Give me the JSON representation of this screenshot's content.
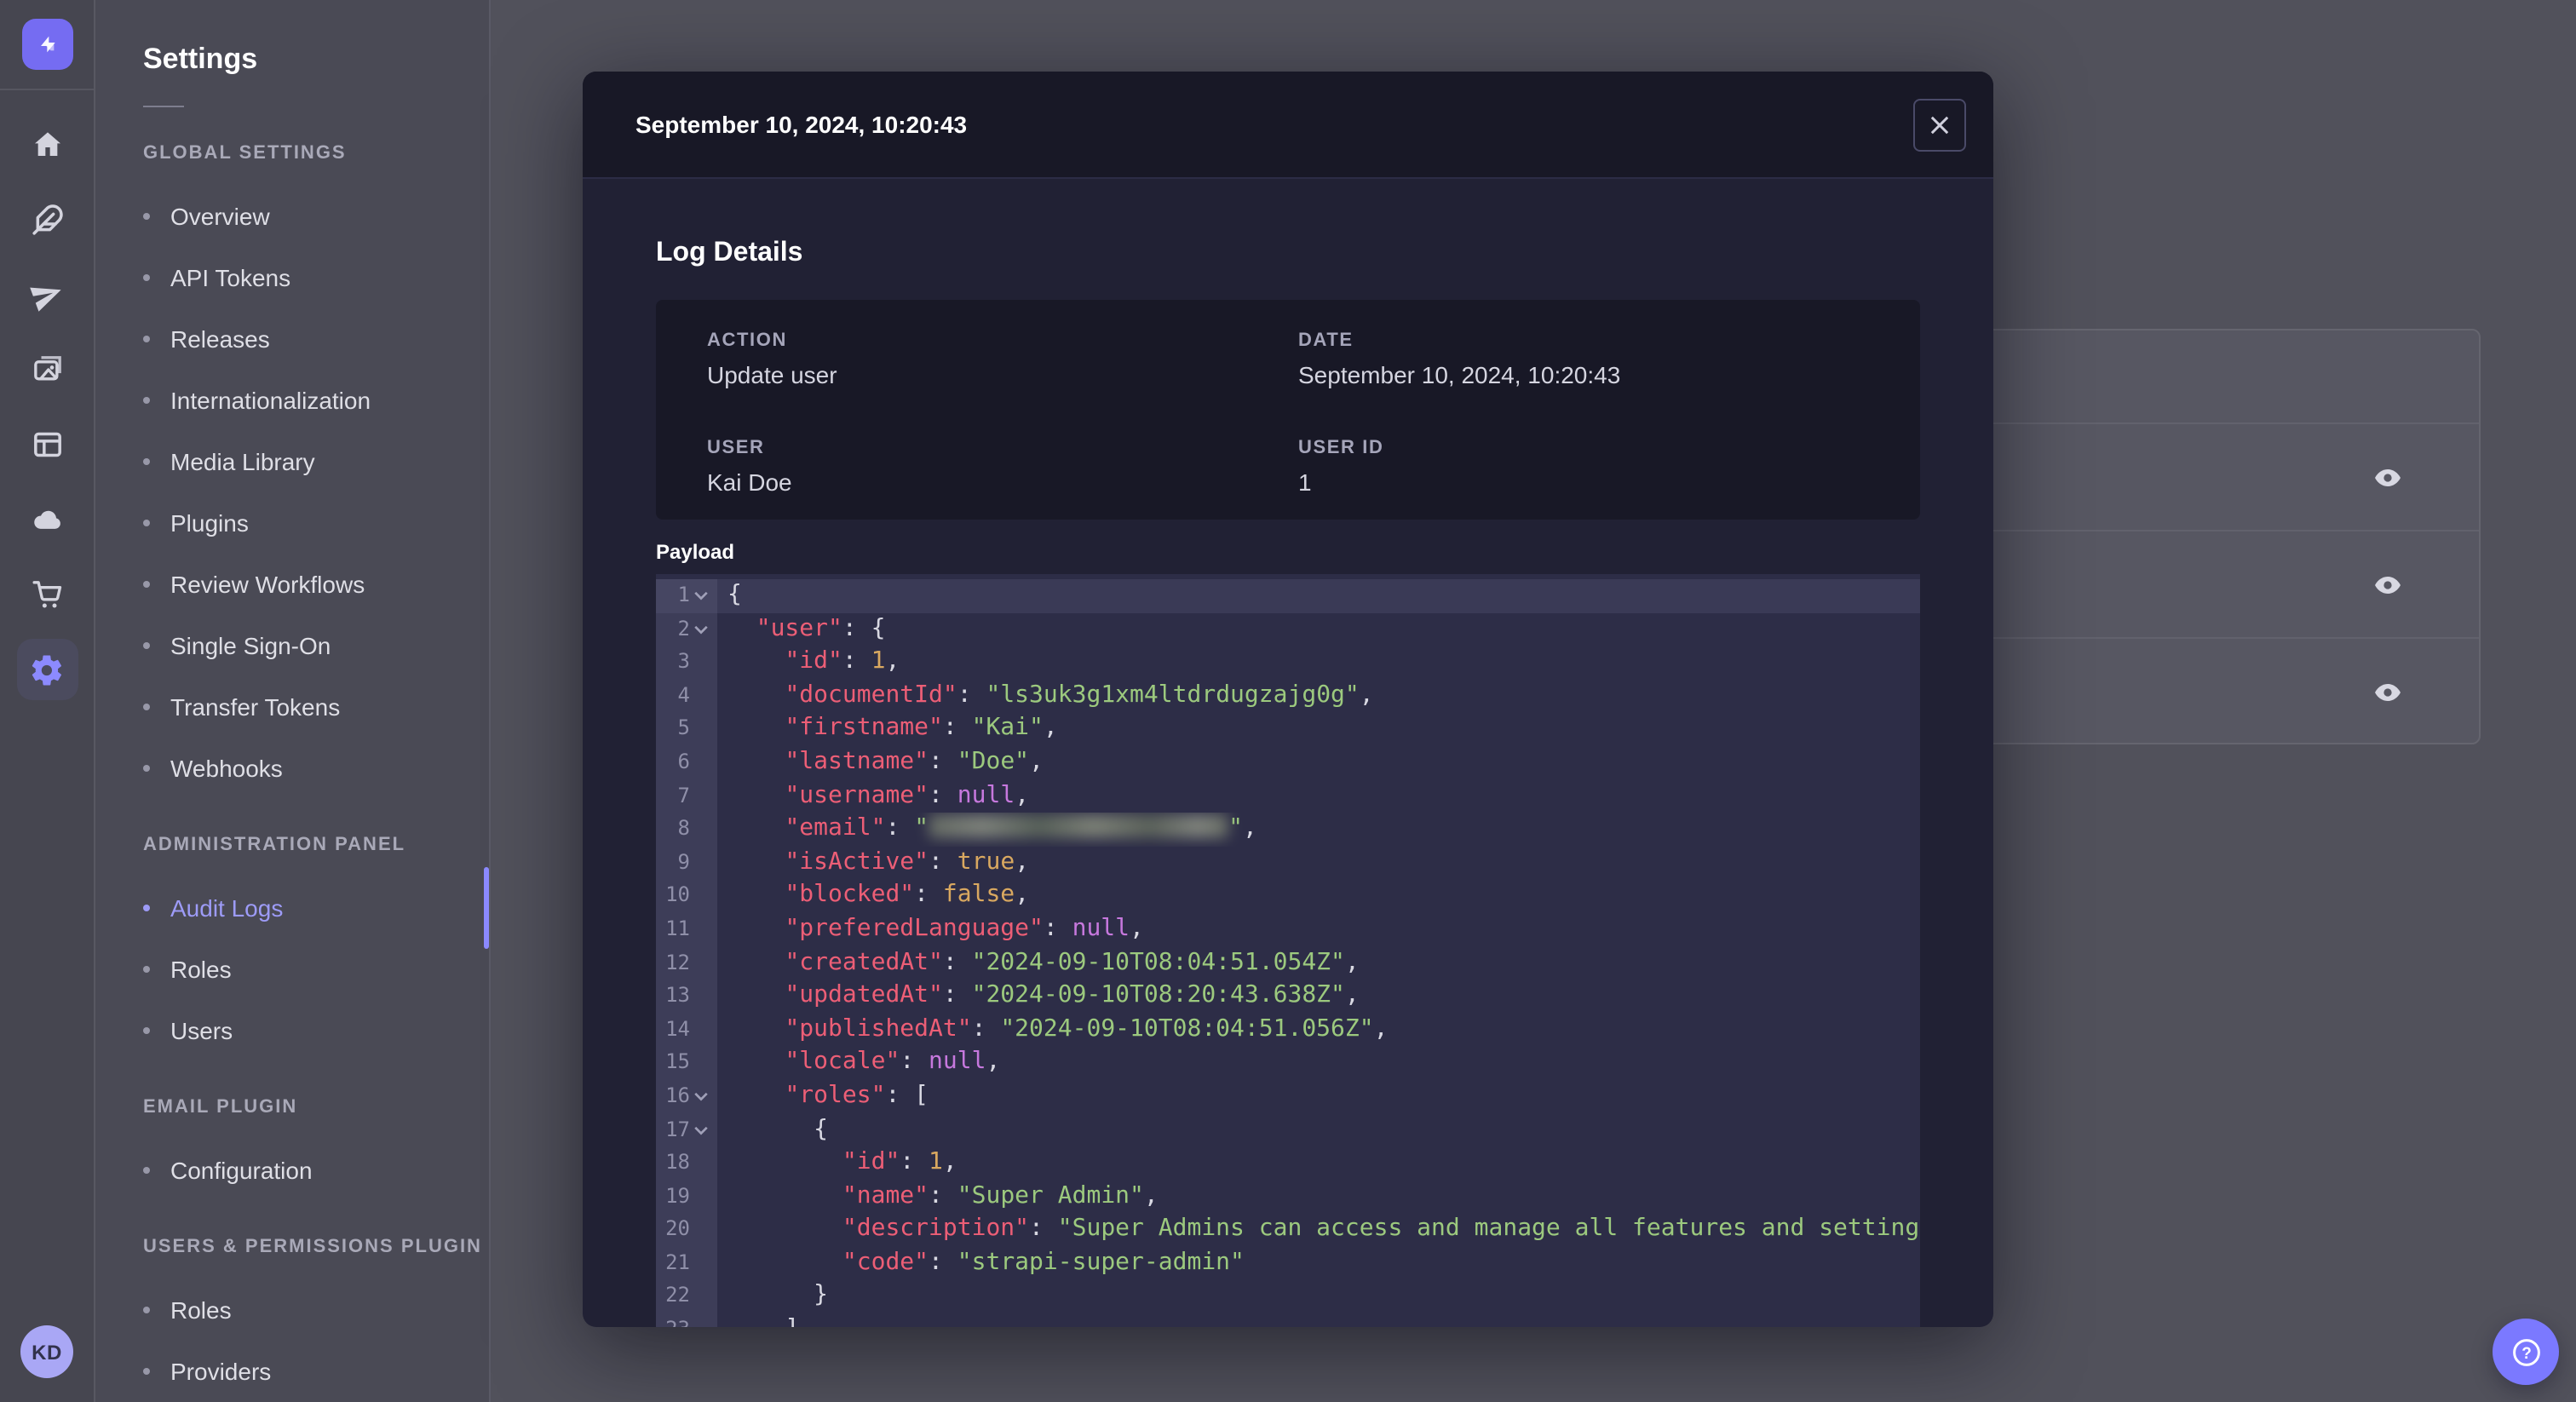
{
  "app": {
    "accent_color": "#7b79ff",
    "active_link_color": "#9d9bf7"
  },
  "rail": {
    "logo_icon": "strapi-logo",
    "icons": [
      {
        "name": "home",
        "active": false
      },
      {
        "name": "feather",
        "active": false
      },
      {
        "name": "paper-plane",
        "active": false
      },
      {
        "name": "media-library",
        "active": false
      },
      {
        "name": "content-manager",
        "active": false
      },
      {
        "name": "cloud",
        "active": false
      },
      {
        "name": "marketplace-cart",
        "active": false
      },
      {
        "name": "gear",
        "active": true
      }
    ],
    "avatar_initials": "KD"
  },
  "sidebar": {
    "title": "Settings",
    "sections": [
      {
        "header": "GLOBAL SETTINGS",
        "items": [
          {
            "label": "Overview",
            "active": false
          },
          {
            "label": "API Tokens",
            "active": false
          },
          {
            "label": "Releases",
            "active": false
          },
          {
            "label": "Internationalization",
            "active": false
          },
          {
            "label": "Media Library",
            "active": false
          },
          {
            "label": "Plugins",
            "active": false
          },
          {
            "label": "Review Workflows",
            "active": false
          },
          {
            "label": "Single Sign-On",
            "active": false
          },
          {
            "label": "Transfer Tokens",
            "active": false
          },
          {
            "label": "Webhooks",
            "active": false
          }
        ]
      },
      {
        "header": "ADMINISTRATION PANEL",
        "items": [
          {
            "label": "Audit Logs",
            "active": true
          },
          {
            "label": "Roles",
            "active": false
          },
          {
            "label": "Users",
            "active": false
          }
        ]
      },
      {
        "header": "EMAIL PLUGIN",
        "items": [
          {
            "label": "Configuration",
            "active": false
          }
        ]
      },
      {
        "header": "USERS & PERMISSIONS PLUGIN",
        "items": [
          {
            "label": "Roles",
            "active": false
          },
          {
            "label": "Providers",
            "active": false
          }
        ]
      }
    ]
  },
  "background_table": {
    "rows": [
      {
        "action_icon": "eye"
      },
      {
        "action_icon": "eye"
      },
      {
        "action_icon": "eye"
      }
    ]
  },
  "modal": {
    "header_title": "September 10, 2024, 10:20:43",
    "close_icon": "close",
    "section_title": "Log Details",
    "details": {
      "fields": [
        {
          "label": "ACTION",
          "value": "Update user"
        },
        {
          "label": "DATE",
          "value": "September 10, 2024, 10:20:43"
        },
        {
          "label": "USER",
          "value": "Kai Doe"
        },
        {
          "label": "USER ID",
          "value": "1"
        }
      ]
    },
    "payload_label": "Payload",
    "payload": {
      "syntax_colors": {
        "key": "#ec5e76",
        "string": "#9cc97e",
        "number_bool": "#d9a860",
        "null": "#c678dd",
        "punctuation": "#d8d8e2"
      },
      "lines": [
        {
          "num": 1,
          "fold": true,
          "active": true,
          "tokens": [
            [
              "p",
              "{"
            ]
          ]
        },
        {
          "num": 2,
          "fold": true,
          "tokens": [
            [
              "p",
              "  "
            ],
            [
              "k",
              "\"user\""
            ],
            [
              "p",
              ": {"
            ]
          ]
        },
        {
          "num": 3,
          "tokens": [
            [
              "p",
              "    "
            ],
            [
              "k",
              "\"id\""
            ],
            [
              "p",
              ": "
            ],
            [
              "n",
              "1"
            ],
            [
              "p",
              ","
            ]
          ]
        },
        {
          "num": 4,
          "tokens": [
            [
              "p",
              "    "
            ],
            [
              "k",
              "\"documentId\""
            ],
            [
              "p",
              ": "
            ],
            [
              "s",
              "\"ls3uk3g1xm4ltdrdugzajg0g\""
            ],
            [
              "p",
              ","
            ]
          ]
        },
        {
          "num": 5,
          "tokens": [
            [
              "p",
              "    "
            ],
            [
              "k",
              "\"firstname\""
            ],
            [
              "p",
              ": "
            ],
            [
              "s",
              "\"Kai\""
            ],
            [
              "p",
              ","
            ]
          ]
        },
        {
          "num": 6,
          "tokens": [
            [
              "p",
              "    "
            ],
            [
              "k",
              "\"lastname\""
            ],
            [
              "p",
              ": "
            ],
            [
              "s",
              "\"Doe\""
            ],
            [
              "p",
              ","
            ]
          ]
        },
        {
          "num": 7,
          "tokens": [
            [
              "p",
              "    "
            ],
            [
              "k",
              "\"username\""
            ],
            [
              "p",
              ": "
            ],
            [
              "u",
              "null"
            ],
            [
              "p",
              ","
            ]
          ]
        },
        {
          "num": 8,
          "tokens": [
            [
              "p",
              "    "
            ],
            [
              "k",
              "\"email\""
            ],
            [
              "p",
              ": "
            ],
            [
              "s",
              "\""
            ],
            [
              "r",
              ""
            ],
            [
              "s",
              "\""
            ],
            [
              "p",
              ","
            ]
          ]
        },
        {
          "num": 9,
          "tokens": [
            [
              "p",
              "    "
            ],
            [
              "k",
              "\"isActive\""
            ],
            [
              "p",
              ": "
            ],
            [
              "n",
              "true"
            ],
            [
              "p",
              ","
            ]
          ]
        },
        {
          "num": 10,
          "tokens": [
            [
              "p",
              "    "
            ],
            [
              "k",
              "\"blocked\""
            ],
            [
              "p",
              ": "
            ],
            [
              "n",
              "false"
            ],
            [
              "p",
              ","
            ]
          ]
        },
        {
          "num": 11,
          "tokens": [
            [
              "p",
              "    "
            ],
            [
              "k",
              "\"preferedLanguage\""
            ],
            [
              "p",
              ": "
            ],
            [
              "u",
              "null"
            ],
            [
              "p",
              ","
            ]
          ]
        },
        {
          "num": 12,
          "tokens": [
            [
              "p",
              "    "
            ],
            [
              "k",
              "\"createdAt\""
            ],
            [
              "p",
              ": "
            ],
            [
              "s",
              "\"2024-09-10T08:04:51.054Z\""
            ],
            [
              "p",
              ","
            ]
          ]
        },
        {
          "num": 13,
          "tokens": [
            [
              "p",
              "    "
            ],
            [
              "k",
              "\"updatedAt\""
            ],
            [
              "p",
              ": "
            ],
            [
              "s",
              "\"2024-09-10T08:20:43.638Z\""
            ],
            [
              "p",
              ","
            ]
          ]
        },
        {
          "num": 14,
          "tokens": [
            [
              "p",
              "    "
            ],
            [
              "k",
              "\"publishedAt\""
            ],
            [
              "p",
              ": "
            ],
            [
              "s",
              "\"2024-09-10T08:04:51.056Z\""
            ],
            [
              "p",
              ","
            ]
          ]
        },
        {
          "num": 15,
          "tokens": [
            [
              "p",
              "    "
            ],
            [
              "k",
              "\"locale\""
            ],
            [
              "p",
              ": "
            ],
            [
              "u",
              "null"
            ],
            [
              "p",
              ","
            ]
          ]
        },
        {
          "num": 16,
          "fold": true,
          "tokens": [
            [
              "p",
              "    "
            ],
            [
              "k",
              "\"roles\""
            ],
            [
              "p",
              ": ["
            ]
          ]
        },
        {
          "num": 17,
          "fold": true,
          "tokens": [
            [
              "p",
              "      {"
            ]
          ]
        },
        {
          "num": 18,
          "tokens": [
            [
              "p",
              "        "
            ],
            [
              "k",
              "\"id\""
            ],
            [
              "p",
              ": "
            ],
            [
              "n",
              "1"
            ],
            [
              "p",
              ","
            ]
          ]
        },
        {
          "num": 19,
          "tokens": [
            [
              "p",
              "        "
            ],
            [
              "k",
              "\"name\""
            ],
            [
              "p",
              ": "
            ],
            [
              "s",
              "\"Super Admin\""
            ],
            [
              "p",
              ","
            ]
          ]
        },
        {
          "num": 20,
          "tokens": [
            [
              "p",
              "        "
            ],
            [
              "k",
              "\"description\""
            ],
            [
              "p",
              ": "
            ],
            [
              "s",
              "\"Super Admins can access and manage all features and settings."
            ]
          ]
        },
        {
          "num": 21,
          "tokens": [
            [
              "p",
              "        "
            ],
            [
              "k",
              "\"code\""
            ],
            [
              "p",
              ": "
            ],
            [
              "s",
              "\"strapi-super-admin\""
            ]
          ]
        },
        {
          "num": 22,
          "tokens": [
            [
              "p",
              "      }"
            ]
          ]
        },
        {
          "num": 23,
          "tokens": [
            [
              "p",
              "    ]"
            ]
          ]
        }
      ]
    }
  },
  "help_button": {
    "icon": "question-mark"
  }
}
